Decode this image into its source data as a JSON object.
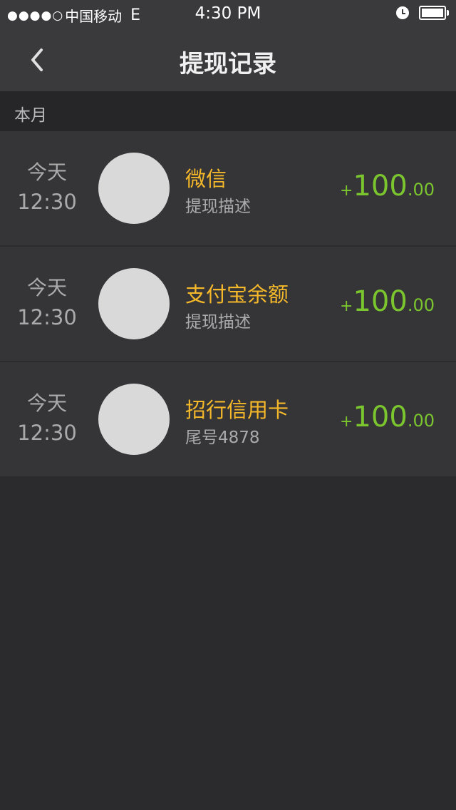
{
  "status_bar": {
    "signal": "●●●●○",
    "carrier": "中国移动",
    "network": "E",
    "time": "4:30 PM"
  },
  "nav": {
    "title": "提现记录",
    "back_icon": "chevron-left-icon"
  },
  "section": {
    "label": "本月"
  },
  "records": [
    {
      "day": "今天",
      "time": "12:30",
      "title": "微信",
      "desc": "提现描述",
      "sign": "+",
      "amount_int": "100",
      "amount_dec": ".00"
    },
    {
      "day": "今天",
      "time": "12:30",
      "title": "支付宝余额",
      "desc": "提现描述",
      "sign": "+",
      "amount_int": "100",
      "amount_dec": ".00"
    },
    {
      "day": "今天",
      "time": "12:30",
      "title": "招行信用卡",
      "desc": "尾号4878",
      "sign": "+",
      "amount_int": "100",
      "amount_dec": ".00"
    }
  ],
  "colors": {
    "title": "#f5b82a",
    "amount": "#7bc52e",
    "background": "#2b2b2d"
  }
}
